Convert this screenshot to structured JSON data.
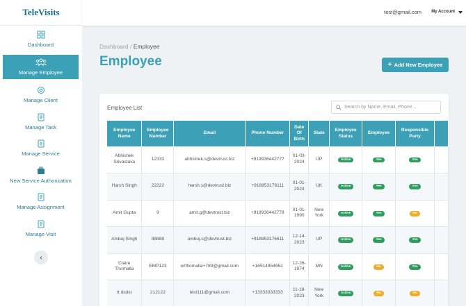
{
  "app": {
    "logo": "TeleVisits"
  },
  "header": {
    "user_email": "test@gmail.com",
    "account_label": "My Account"
  },
  "sidebar": {
    "items": [
      {
        "label": "Dashboard",
        "icon": "grid-icon"
      },
      {
        "label": "Manage Employee",
        "icon": "users-icon",
        "active": true
      },
      {
        "label": "Manage Client",
        "icon": "settings-icon"
      },
      {
        "label": "Manage Task",
        "icon": "document-icon"
      },
      {
        "label": "Manage Service",
        "icon": "document-icon"
      },
      {
        "label": "New Service Authorization",
        "icon": "briefcase-icon"
      },
      {
        "label": "Manage Assignment",
        "icon": "document-icon"
      },
      {
        "label": "Manage Visit",
        "icon": "document-icon"
      }
    ],
    "collapse_label": "‹"
  },
  "breadcrumb": {
    "root": "Dashboard",
    "separator": " / ",
    "current": "Employee"
  },
  "page": {
    "title": "Employee",
    "add_button": "Add New Employee"
  },
  "card": {
    "title": "Employee List",
    "search_placeholder": "Search by Name, Email, Phone..."
  },
  "table": {
    "columns": [
      "Employee Name",
      "Employee Number",
      "Email",
      "Phone Number",
      "Date Of Birth",
      "State",
      "Employee Status",
      "Employee",
      "Responsible Party"
    ],
    "rows": [
      {
        "name": "Abhishek Srivastava",
        "number": "12333",
        "email": "abhishek.s@devtrust.biz",
        "phone": "+919936442777",
        "dob": "01-03-2024",
        "state": "UP",
        "status": "Active",
        "employee": "Yes",
        "responsible": "Yes"
      },
      {
        "name": "Harsh Singh",
        "number": "22222",
        "email": "harsh.s@devtrust.biz",
        "phone": "+918953176111",
        "dob": "01-01-2024",
        "state": "UK",
        "status": "Active",
        "employee": "Yes",
        "responsible": "Yes"
      },
      {
        "name": "Amit Gupta",
        "number": "9",
        "email": "amit.g@devtrust.biz",
        "phone": "+919936442778",
        "dob": "01-01-1990",
        "state": "New York",
        "status": "Active",
        "employee": "Yes",
        "responsible": "No"
      },
      {
        "name": "Ambuj Singh",
        "number": "88888",
        "email": "ambuj.s@devtrust.biz",
        "phone": "+918953176611",
        "dob": "12-14-2023",
        "state": "UP",
        "status": "Active",
        "employee": "Yes",
        "responsible": "Yes"
      },
      {
        "name": "Claire Thomalla",
        "number": "EMP123",
        "email": "wrthomalla+789@gmail.com",
        "phone": "+16514854651",
        "dob": "12-26-1974",
        "state": "MN",
        "status": "Active",
        "employee": "No",
        "responsible": "Yes"
      },
      {
        "name": "tt dsdst",
        "number": "212122",
        "email": "test111@gmail.com",
        "phone": "+13333333333",
        "dob": "11-18-2023",
        "state": "New York",
        "status": "Active",
        "employee": "No",
        "responsible": "No"
      }
    ]
  },
  "colors": {
    "accent": "#3ca0b6",
    "active_badge": "#2e9d5e",
    "no_badge": "#f0ad2b"
  }
}
